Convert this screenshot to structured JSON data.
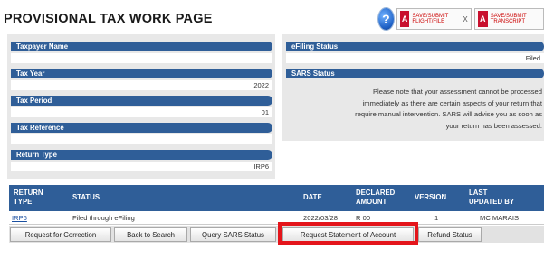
{
  "page": {
    "title": "PROVISIONAL TAX WORK PAGE"
  },
  "toolbar": {
    "help_icon": "?",
    "pdf_caption_1": "SAVE/SUBMIT FLIGHT/FILE",
    "pdf_caption_2": "SAVE/SUBMIT TRANSCRIPT",
    "pdf_close": "X",
    "pdf_logo_text": "A"
  },
  "taxpayer": {
    "name_label": "Taxpayer Name",
    "name_value": "",
    "year_label": "Tax Year",
    "year_value": "2022",
    "period_label": "Tax Period",
    "period_value": "01",
    "reference_label": "Tax Reference",
    "reference_value": "",
    "return_type_label": "Return Type",
    "return_type_value": "IRP6"
  },
  "efiling": {
    "status_label": "eFiling Status",
    "status_value": "Filed",
    "sars_label": "SARS Status",
    "sars_lines": [
      "Please note that your assessment cannot be processed",
      "immediately as there are certain aspects of your return that",
      "require manual intervention. SARS will advise you as soon as",
      "your return has been assessed."
    ]
  },
  "grid": {
    "headers": {
      "return_type": [
        "RETURN",
        "TYPE"
      ],
      "status": "STATUS",
      "date": "DATE",
      "declared_amount": [
        "DECLARED",
        "AMOUNT"
      ],
      "version": "VERSION",
      "last_updated": [
        "LAST",
        "UPDATED BY"
      ]
    },
    "row": {
      "return_type": "IRP6",
      "status": "Filed through eFiling",
      "date": "2022/03/28",
      "declared_amount": "R 00",
      "version": "1",
      "last_updated": "MC MARAIS"
    }
  },
  "buttons": {
    "request_correction": "Request for Correction",
    "back_to_search": "Back to Search",
    "query_sars_status": "Query SARS Status",
    "request_statement": "Request Statement of Account",
    "refund_status": "Refund Status"
  },
  "colors": {
    "header_blue": "#2f5e98",
    "highlight_red": "#e4151b"
  }
}
